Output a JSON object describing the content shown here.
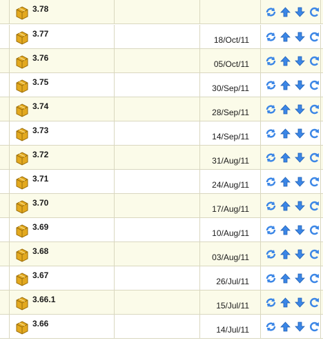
{
  "colors": {
    "row_odd": "#fbfbe9",
    "row_even": "#ffffff",
    "border": "#d9d7bf",
    "icon_blue": "#3b86e6",
    "icon_gold": "#e3a91f"
  },
  "icons": {
    "package": "package-icon",
    "actions": [
      "refresh-icon",
      "arrow-up-icon",
      "arrow-down-icon",
      "reload-icon"
    ]
  },
  "rows": [
    {
      "version": "3.78",
      "date": ""
    },
    {
      "version": "3.77",
      "date": "18/Oct/11"
    },
    {
      "version": "3.76",
      "date": "05/Oct/11"
    },
    {
      "version": "3.75",
      "date": "30/Sep/11"
    },
    {
      "version": "3.74",
      "date": "28/Sep/11"
    },
    {
      "version": "3.73",
      "date": "14/Sep/11"
    },
    {
      "version": "3.72",
      "date": "31/Aug/11"
    },
    {
      "version": "3.71",
      "date": "24/Aug/11"
    },
    {
      "version": "3.70",
      "date": "17/Aug/11"
    },
    {
      "version": "3.69",
      "date": "10/Aug/11"
    },
    {
      "version": "3.68",
      "date": "03/Aug/11"
    },
    {
      "version": "3.67",
      "date": "26/Jul/11"
    },
    {
      "version": "3.66.1",
      "date": "15/Jul/11"
    },
    {
      "version": "3.66",
      "date": "14/Jul/11"
    }
  ]
}
